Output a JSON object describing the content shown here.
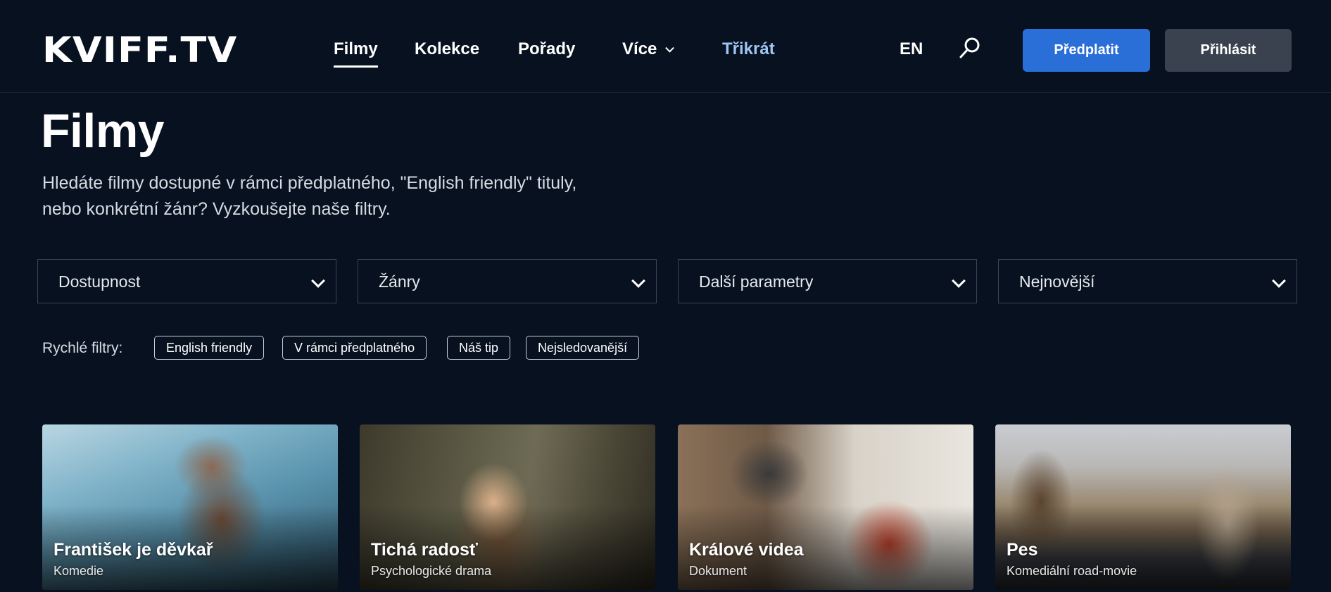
{
  "header": {
    "logo": "KVIFF.TV",
    "nav": [
      {
        "label": "Filmy",
        "active": true
      },
      {
        "label": "Kolekce"
      },
      {
        "label": "Pořady"
      },
      {
        "label": "Více"
      },
      {
        "label": "Třikrát",
        "accent": true
      }
    ],
    "language": "EN",
    "search_icon": "search-icon",
    "subscribe_label": "Předplatit",
    "login_label": "Přihlásit",
    "colors": {
      "background": "#07111f",
      "primary": "#2a6ed8",
      "secondary": "#3a4250",
      "accent": "#9ec6f5"
    }
  },
  "page": {
    "title": "Filmy",
    "intro_line1": "Hledáte filmy dostupné v rámci předplatného, \"English friendly\" tituly,",
    "intro_line2": "nebo konkrétní žánr? Vyzkoušejte naše filtry."
  },
  "filters": [
    {
      "label": "Dostupnost"
    },
    {
      "label": "Žánry"
    },
    {
      "label": "Další parametry"
    },
    {
      "label": "Nejnovější"
    }
  ],
  "quick_filters": {
    "label": "Rychlé filtry:",
    "chips": [
      "English friendly",
      "V rámci předplatného",
      "Náš tip",
      "Nejsledovanější"
    ]
  },
  "films": [
    {
      "title": "František je děvkař",
      "genre": "Komedie"
    },
    {
      "title": "Tichá radosť",
      "genre": "Psychologické drama"
    },
    {
      "title": "Králové videa",
      "genre": "Dokument"
    },
    {
      "title": "Pes",
      "genre": "Komediální road-movie"
    }
  ]
}
